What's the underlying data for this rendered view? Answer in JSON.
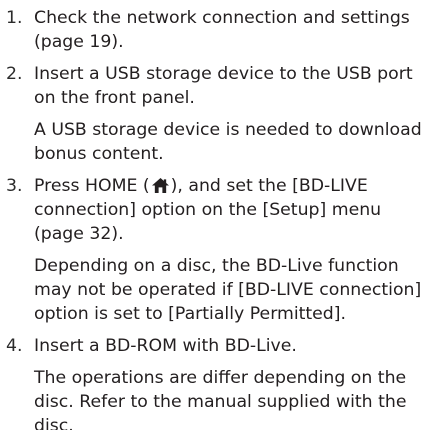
{
  "steps": [
    {
      "number": "1.",
      "text": "Check the network connection and settings (page 19)."
    },
    {
      "number": "2.",
      "text": "Insert a USB storage device to the USB port on the front panel.",
      "note": "A USB storage device is needed to download bonus content."
    },
    {
      "number": "3.",
      "text_before_icon": "Press HOME (",
      "icon": "home-icon",
      "text_after_icon": "), and set the [BD-LIVE connection] option on the [Setup] menu (page 32).",
      "note": "Depending on a disc, the BD-Live function may not be operated if [BD-LIVE connection] option is set to [Partially Permitted]."
    },
    {
      "number": "4.",
      "text": "Insert a BD-ROM with BD-Live.",
      "note": "The operations are differ depending on the disc. Refer to the manual supplied with the disc."
    }
  ]
}
